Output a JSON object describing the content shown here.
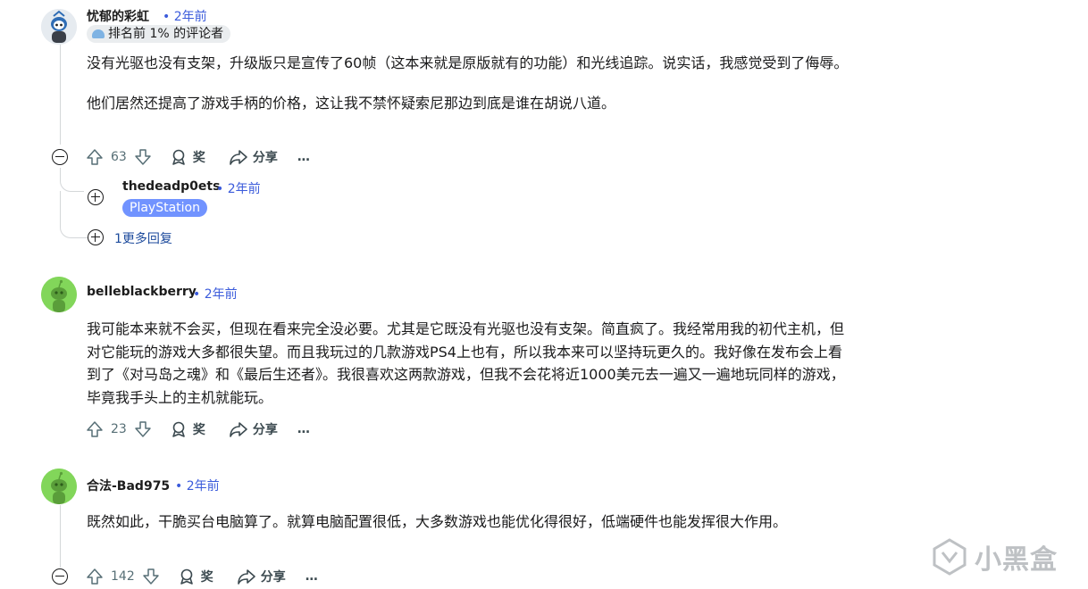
{
  "comments": [
    {
      "author": "忧郁的彩虹",
      "time": "• 2年前",
      "flair": "排名前 1% 的评论者",
      "paragraphs": [
        "没有光驱也没有支架，升级版只是宣传了60帧（这本来就是原版就有的功能）和光线追踪。说实话，我感觉受到了侮辱。",
        "他们居然还提高了游戏手柄的价格，这让我不禁怀疑索尼那边到底是谁在胡说八道。"
      ],
      "votes": "63",
      "award": "奖",
      "share": "分享",
      "more": "…",
      "reply": {
        "author": "thedeadp0ets",
        "time": "• 2年前",
        "flair": "PlayStation"
      },
      "more_replies": "1更多回复"
    },
    {
      "author": "belleblackberry",
      "time": "• 2年前",
      "paragraphs": [
        "我可能本来就不会买，但现在看来完全没必要。尤其是它既没有光驱也没有支架。简直疯了。我经常用我的初代主机，但对它能玩的游戏大多都很失望。而且我玩过的几款游戏PS4上也有，所以我本来可以坚持玩更久的。我好像在发布会上看到了《对马岛之魂》和《最后生还者》。我很喜欢这两款游戏，但我不会花将近1000美元去一遍又一遍地玩同样的游戏，毕竟我手头上的主机就能玩。"
      ],
      "votes": "23",
      "award": "奖",
      "share": "分享",
      "more": "…"
    },
    {
      "author": "合法-Bad975",
      "time": "• 2年前",
      "paragraphs": [
        "既然如此，干脆买台电脑算了。就算电脑配置很低，大多数游戏也能优化得很好，低端硬件也能发挥很大作用。"
      ],
      "votes": "142",
      "award": "奖",
      "share": "分享",
      "more": "…"
    }
  ],
  "watermark": "小黑盒",
  "colors": {
    "flair_playstation": "#7193ff",
    "flair_top": "#eaedef",
    "avatar_green": "#82d65a",
    "time_blue": "#3b5bdb"
  }
}
